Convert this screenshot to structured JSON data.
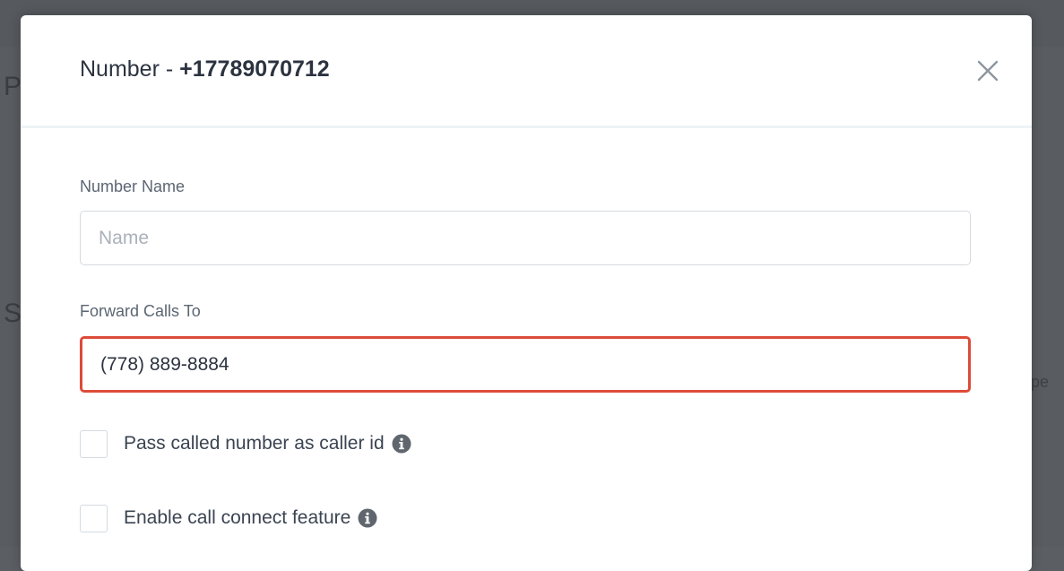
{
  "background": {
    "fragment_left_top": "P",
    "fragment_left_mid": "S",
    "fragment_right": "pe"
  },
  "modal": {
    "title_prefix": "Number - ",
    "title_number": "+17789070712",
    "close_icon": "close-icon",
    "number_name": {
      "label": "Number Name",
      "placeholder": "Name",
      "value": ""
    },
    "forward_calls": {
      "label": "Forward Calls To",
      "value": "(778) 889-8884",
      "state": "error",
      "error_color": "#dd4b39"
    },
    "options": [
      {
        "label": "Pass called number as caller id",
        "checked": false,
        "icon": "info-icon"
      },
      {
        "label": "Enable call connect feature",
        "checked": false,
        "icon": "info-icon"
      }
    ]
  }
}
